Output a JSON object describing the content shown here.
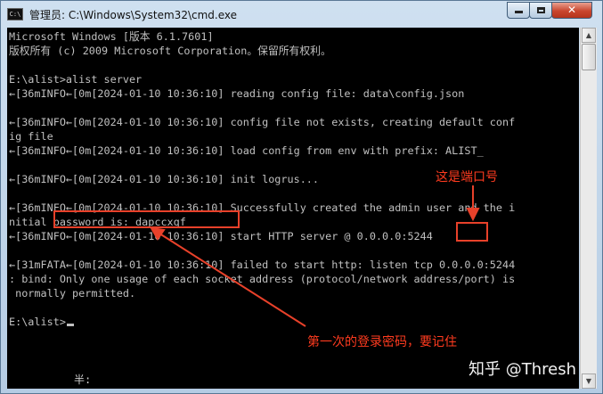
{
  "window": {
    "title": "管理员: C:\\Windows\\System32\\cmd.exe",
    "icon_label": "C:\\",
    "icon": "terminal-icon",
    "controls": {
      "minimize_icon": "minimize-icon",
      "maximize_icon": "maximize-icon",
      "close_label": "✕"
    }
  },
  "console": {
    "lines": [
      "Microsoft Windows [版本 6.1.7601]",
      "版权所有 (c) 2009 Microsoft Corporation。保留所有权利。",
      "",
      "E:\\alist>alist server",
      "←[36mINFO←[0m[2024-01-10 10:36:10] reading config file: data\\config.json",
      "",
      "←[36mINFO←[0m[2024-01-10 10:36:10] config file not exists, creating default conf",
      "ig file",
      "←[36mINFO←[0m[2024-01-10 10:36:10] load config from env with prefix: ALIST_",
      "",
      "←[36mINFO←[0m[2024-01-10 10:36:10] init logrus...",
      "",
      "←[36mINFO←[0m[2024-01-10 10:36:10] Successfully created the admin user and the i",
      "nitial password is: dapccxqf",
      "←[36mINFO←[0m[2024-01-10 10:36:10] start HTTP server @ 0.0.0.0:5244",
      "",
      "←[31mFATA←[0m[2024-01-10 10:36:10] failed to start http: listen tcp 0.0.0.0:5244",
      ": bind: Only one usage of each socket address (protocol/network address/port) is",
      " normally permitted.",
      "",
      "E:\\alist>"
    ],
    "ime_indicator": "半:"
  },
  "annotations": {
    "port_note": "这是端口号",
    "password_note": "第一次的登录密码，要记住",
    "color": "#e8412a"
  },
  "watermark": "知乎 @Thresh",
  "colors": {
    "console_bg": "#000000",
    "console_fg": "#c0c0c0",
    "titlebar": "#b5cce4",
    "close_button": "#c9462e"
  }
}
